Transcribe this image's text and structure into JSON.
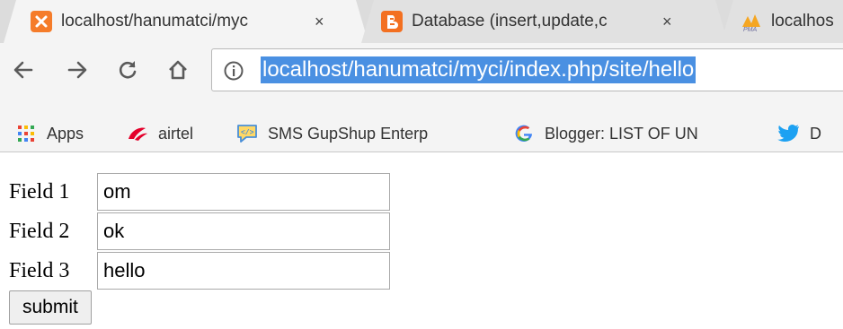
{
  "tabs": [
    {
      "title": "localhost/hanumatci/myc",
      "active": true,
      "favicon": "xampp-icon"
    },
    {
      "title": "Database (insert,update,c",
      "active": false,
      "favicon": "blogger-icon"
    },
    {
      "title": "localhos",
      "active": false,
      "favicon": "phpmyadmin-icon"
    }
  ],
  "tab_close_glyph": "×",
  "address_bar": {
    "url": "localhost/hanumatci/myci/index.php/site/hello",
    "selected": true,
    "selection_color": "#4a90e2"
  },
  "bookmarks": [
    {
      "label": "Apps",
      "icon": "apps-grid-icon"
    },
    {
      "label": "airtel",
      "icon": "airtel-icon"
    },
    {
      "label": "SMS GupShup Enterp",
      "icon": "sms-gupshup-icon"
    },
    {
      "label": "Blogger: LIST OF UNI\\",
      "icon": "google-icon"
    },
    {
      "label": "D",
      "icon": "twitter-icon"
    }
  ],
  "form": {
    "fields": [
      {
        "label": "Field 1",
        "value": "om"
      },
      {
        "label": "Field 2",
        "value": "ok"
      },
      {
        "label": "Field 3",
        "value": "hello"
      }
    ],
    "submit_label": "submit"
  },
  "colors": {
    "xampp": "#f57c2a",
    "blogger": "#f37021",
    "airtel": "#e4002b",
    "twitter": "#1da1f2"
  }
}
